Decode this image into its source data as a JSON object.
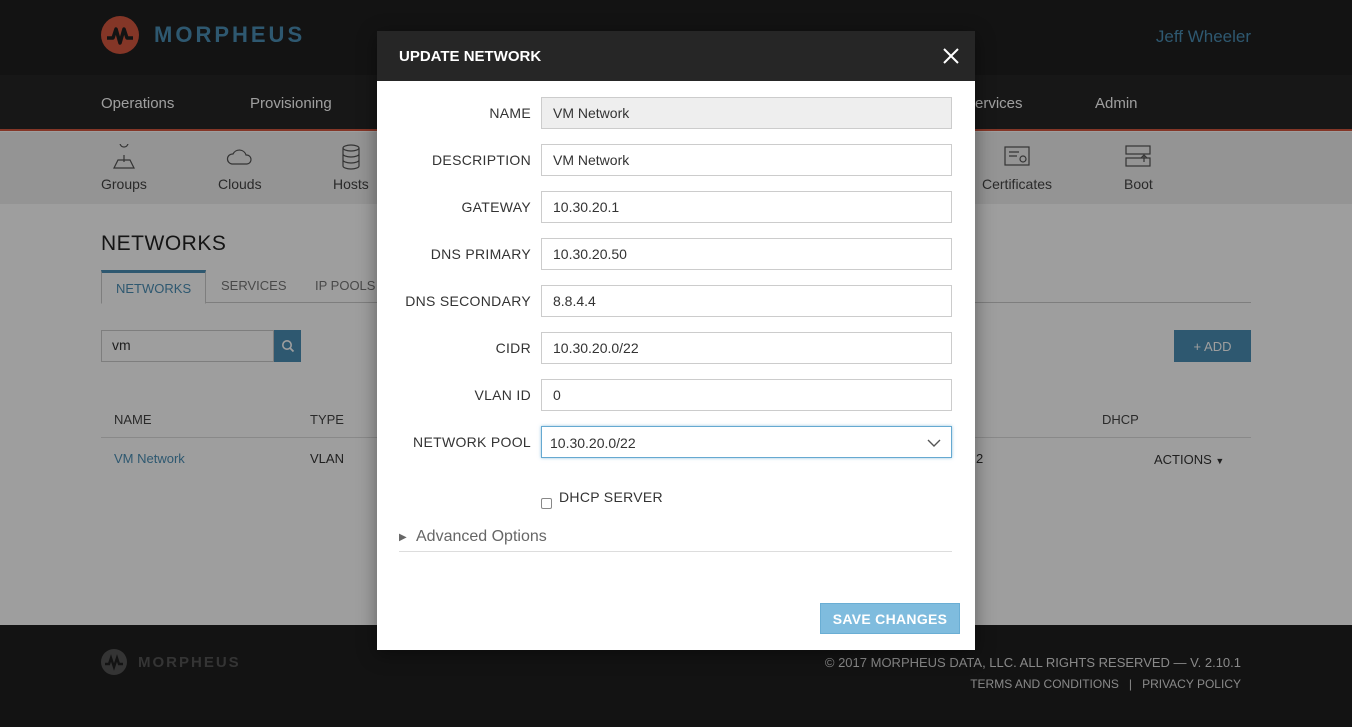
{
  "brand": {
    "name": "MORPHEUS"
  },
  "user": {
    "name": "Jeff Wheeler"
  },
  "main_nav": [
    "Operations",
    "Provisioning",
    "ervices",
    "Admin"
  ],
  "sub_nav": [
    {
      "label": "Groups",
      "icon": "groups-icon"
    },
    {
      "label": "Clouds",
      "icon": "clouds-icon"
    },
    {
      "label": "Hosts",
      "icon": "hosts-icon"
    },
    {
      "label": "Certificates",
      "icon": "certificates-icon"
    },
    {
      "label": "Boot",
      "icon": "boot-icon"
    }
  ],
  "page": {
    "title": "NETWORKS"
  },
  "tabs": [
    "NETWORKS",
    "SERVICES",
    "IP POOLS"
  ],
  "search": {
    "value": "vm"
  },
  "add_button": "+ ADD",
  "table": {
    "headers": {
      "name": "NAME",
      "type": "TYPE",
      "dhcp": "DHCP"
    },
    "row": {
      "name": "VM Network",
      "type": "VLAN",
      "partial": "2",
      "actions": "ACTIONS"
    }
  },
  "footer": {
    "brand": "MORPHEUS",
    "copyright": "© 2017 MORPHEUS DATA, LLC. ALL RIGHTS RESERVED — V. 2.10.1",
    "terms": "TERMS AND CONDITIONS",
    "separator": "|",
    "privacy": "PRIVACY POLICY"
  },
  "modal": {
    "title": "UPDATE NETWORK",
    "fields": {
      "name": {
        "label": "NAME",
        "value": "VM Network"
      },
      "description": {
        "label": "DESCRIPTION",
        "value": "VM Network"
      },
      "gateway": {
        "label": "GATEWAY",
        "value": "10.30.20.1"
      },
      "dns_primary": {
        "label": "DNS PRIMARY",
        "value": "10.30.20.50"
      },
      "dns_secondary": {
        "label": "DNS SECONDARY",
        "value": "8.8.4.4"
      },
      "cidr": {
        "label": "CIDR",
        "value": "10.30.20.0/22"
      },
      "vlan_id": {
        "label": "VLAN ID",
        "value": "0"
      },
      "network_pool": {
        "label": "NETWORK POOL",
        "value": "10.30.20.0/22"
      }
    },
    "dhcp_label": "DHCP SERVER",
    "advanced_label": "Advanced Options",
    "save_label": "SAVE CHANGES"
  },
  "colors": {
    "accent": "#4b8fb5",
    "brand_red": "#d5573f",
    "header_dark": "#262626",
    "save_button": "#7fbcde"
  }
}
